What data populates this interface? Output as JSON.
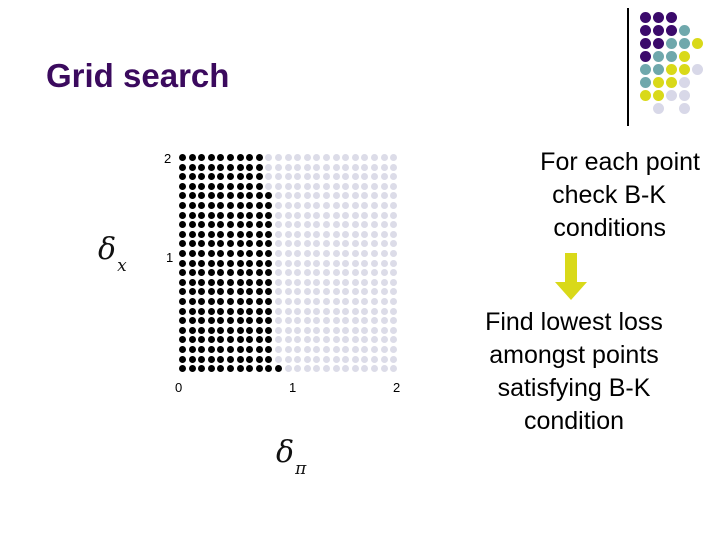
{
  "slide": {
    "title": "Grid search",
    "title_color": "#3b0a5e",
    "background": "#ffffff"
  },
  "decoration": {
    "name": "corner-dot-motif",
    "divider_color": "#000000",
    "palette": {
      "purple": "#3b0a6b",
      "teal": "#6fa8ac",
      "yellow": "#d9d919",
      "lavender": "#d8d8e8"
    },
    "dot_size": 11,
    "pitch_x": 13,
    "pitch_y": 13,
    "origin": [
      20,
      12
    ],
    "rows": [
      [
        "purple",
        "purple",
        "purple",
        null,
        null,
        null
      ],
      [
        "purple",
        "purple",
        "purple",
        "teal",
        null,
        null
      ],
      [
        "purple",
        "purple",
        "teal",
        "teal",
        "yellow",
        null
      ],
      [
        "purple",
        "teal",
        "teal",
        "yellow",
        null,
        null
      ],
      [
        "teal",
        "teal",
        "yellow",
        "yellow",
        "lavender",
        null
      ],
      [
        "teal",
        "yellow",
        "yellow",
        "lavender",
        null,
        null
      ],
      [
        "yellow",
        "yellow",
        "lavender",
        "lavender",
        null,
        null
      ],
      [
        null,
        "lavender",
        null,
        "lavender",
        null,
        null
      ]
    ]
  },
  "chart_data": {
    "type": "scatter",
    "title": "",
    "xlabel": "δ",
    "xlabel_sub": "π",
    "ylabel": "δ",
    "ylabel_sub": "x",
    "xticks": [
      "0",
      "1",
      "2"
    ],
    "yticks": [
      "2",
      "1"
    ],
    "xlim": [
      0,
      2.2
    ],
    "ylim": [
      0,
      2.2
    ],
    "grid": false,
    "legend": "none",
    "dot_size": 7,
    "pitch_x": 9.6,
    "pitch_y": 9.6,
    "n_cols": 23,
    "n_rows": 23,
    "colors": {
      "selected": "#000000",
      "unselected": "#dcdce8"
    },
    "description": "Regular lattice of candidate grid-search points; points left of a stepped boundary are highlighted black (satisfying region), the rest are faint lavender.",
    "black_cols_per_row": [
      9,
      9,
      9,
      9,
      10,
      10,
      10,
      10,
      10,
      10,
      10,
      10,
      10,
      10,
      10,
      10,
      10,
      10,
      10,
      10,
      10,
      10,
      11
    ]
  },
  "annotations": {
    "top_note": {
      "line1": "For each point",
      "line2": "check B-K",
      "line3": "conditions"
    },
    "arrow": {
      "name": "down-arrow",
      "color": "#d9d919",
      "direction": "down"
    },
    "bottom_note": {
      "line1": "Find lowest loss",
      "line2": "amongst points",
      "line3": "satisfying B-K",
      "line4": "condition"
    }
  }
}
